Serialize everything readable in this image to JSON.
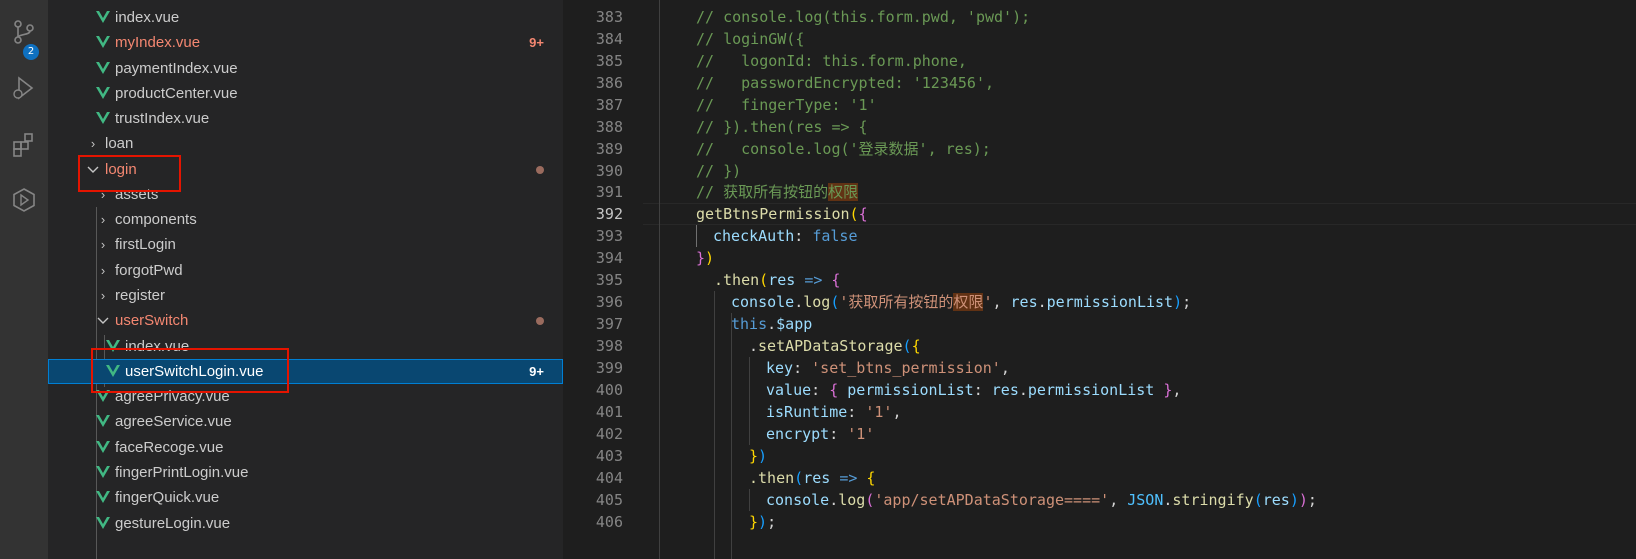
{
  "activity_bar": {
    "icons": [
      "source-control-icon",
      "run-debug-icon",
      "extensions-icon",
      "remote-icon"
    ],
    "scm_badge": "2"
  },
  "explorer": {
    "items": [
      {
        "label": "index.vue",
        "kind": "vue"
      },
      {
        "label": "myIndex.vue",
        "kind": "vue",
        "count": "9+"
      },
      {
        "label": "paymentIndex.vue",
        "kind": "vue"
      },
      {
        "label": "productCenter.vue",
        "kind": "vue"
      },
      {
        "label": "trustIndex.vue",
        "kind": "vue"
      },
      {
        "label": "loan",
        "kind": "folder",
        "state": "collapsed"
      },
      {
        "label": "login",
        "kind": "folder",
        "state": "expanded"
      },
      {
        "label": "assets",
        "kind": "folder",
        "state": "collapsed"
      },
      {
        "label": "components",
        "kind": "folder",
        "state": "collapsed"
      },
      {
        "label": "firstLogin",
        "kind": "folder",
        "state": "collapsed"
      },
      {
        "label": "forgotPwd",
        "kind": "folder",
        "state": "collapsed"
      },
      {
        "label": "register",
        "kind": "folder",
        "state": "collapsed"
      },
      {
        "label": "userSwitch",
        "kind": "folder",
        "state": "expanded"
      },
      {
        "label": "index.vue",
        "kind": "vue"
      },
      {
        "label": "userSwitchLogin.vue",
        "kind": "vue",
        "count": "9+",
        "selected": true
      },
      {
        "label": "agreePrivacy.vue",
        "kind": "vue"
      },
      {
        "label": "agreeService.vue",
        "kind": "vue"
      },
      {
        "label": "faceRecoge.vue",
        "kind": "vue"
      },
      {
        "label": "fingerPrintLogin.vue",
        "kind": "vue"
      },
      {
        "label": "fingerQuick.vue",
        "kind": "vue"
      },
      {
        "label": "gestureLogin.vue",
        "kind": "vue"
      }
    ]
  },
  "editor": {
    "line_numbers": [
      "383",
      "384",
      "385",
      "386",
      "387",
      "388",
      "389",
      "390",
      "391",
      "392",
      "393",
      "394",
      "395",
      "396",
      "397",
      "398",
      "399",
      "400",
      "401",
      "402",
      "403",
      "404",
      "405",
      "406"
    ],
    "active_line": "392",
    "code": {
      "l0": "// console.log(this.form.pwd, 'pwd');",
      "l1": "// loginGW({",
      "l2": "//   logonId: this.form.phone,",
      "l3": "//   passwordEncrypted: '123456',",
      "l4": "//   fingerType: '1'",
      "l5": "// }).then(res => {",
      "l6": "//   console.log('登录数据', res);",
      "l7": "// })",
      "l8a": "// 获取所有按钮的",
      "l8b": "权限",
      "l9a": "getBtnsPermission",
      "l10a": "checkAuth",
      "l10b": "false",
      "l12a": ".then",
      "l12b": "res",
      "l13a": "console",
      "l13b": "log",
      "l13c": "'获取所有按钮的",
      "l13d": "权限",
      "l13e": "'",
      "l13f": "res",
      "l13g": "permissionList",
      "l14a": "this",
      "l14b": "$app",
      "l15a": "setAPDataStorage",
      "l16a": "key",
      "l16b": "'set_btns_permission'",
      "l17a": "value",
      "l17b": "permissionList",
      "l17c": "res",
      "l17d": "permissionList",
      "l18a": "isRuntime",
      "l18b": "'1'",
      "l19a": "encrypt",
      "l19b": "'1'",
      "l21a": ".then",
      "l21b": "res",
      "l22a": "console",
      "l22b": "log",
      "l22c": "'app/setAPDataStorage===='",
      "l22d": "JSON",
      "l22e": "stringify",
      "l22f": "res"
    }
  }
}
